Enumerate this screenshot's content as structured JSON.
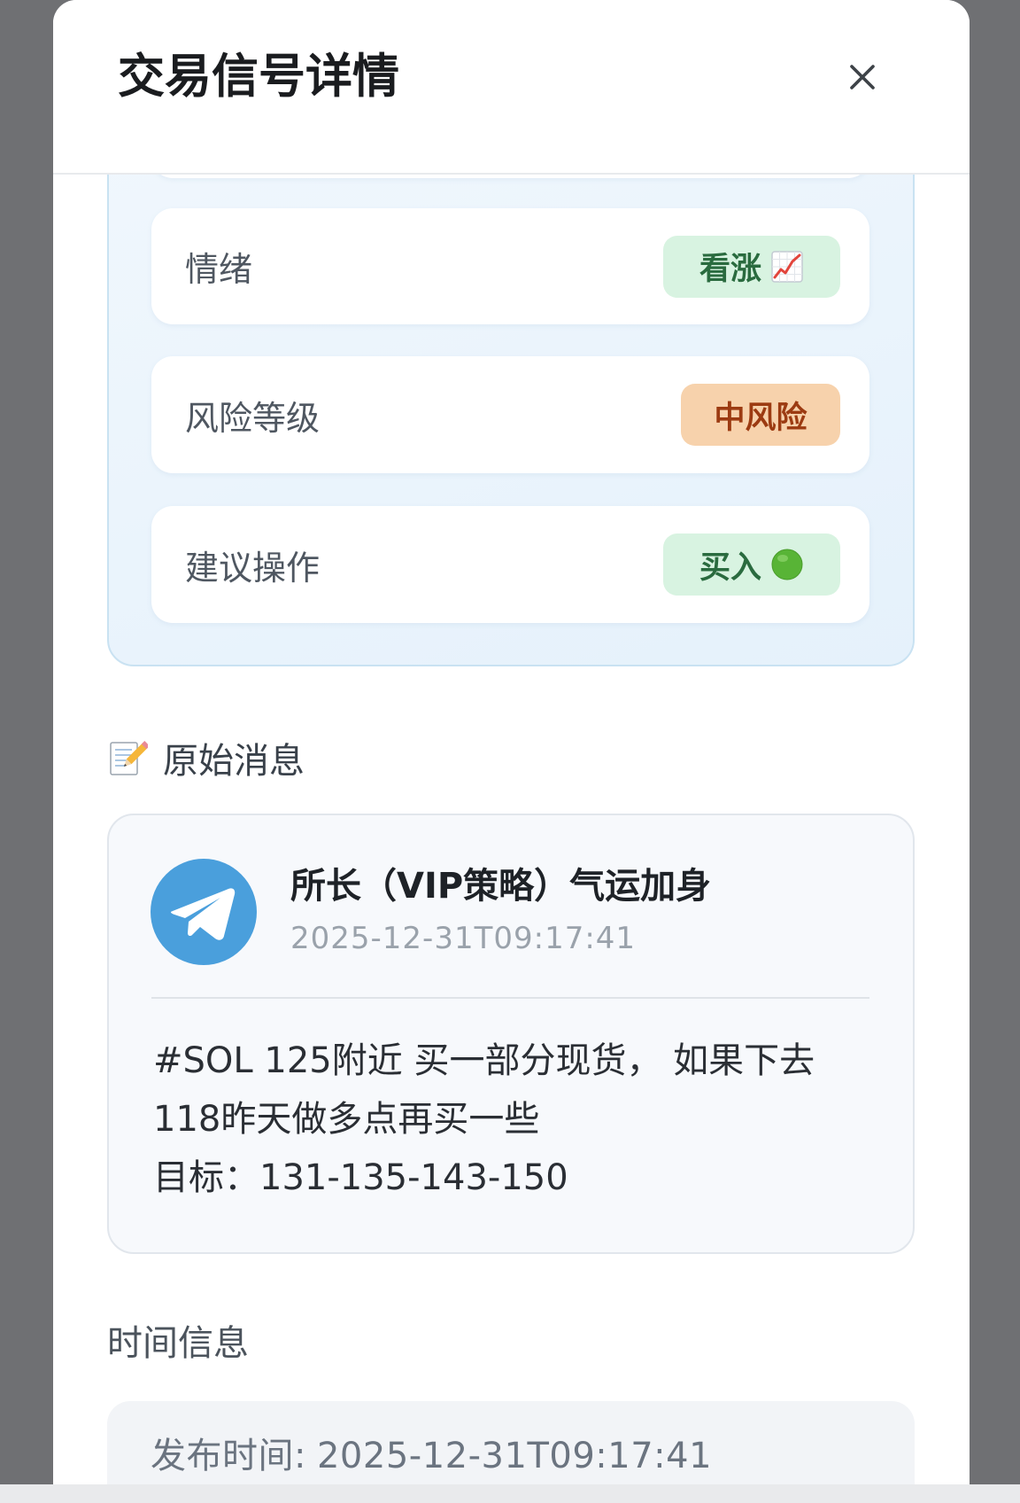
{
  "modal": {
    "title": "交易信号详情",
    "close_icon": "close-icon"
  },
  "signal": {
    "rows": [
      {
        "label": "情绪",
        "value": "看涨",
        "icon": "chart-increasing-icon",
        "badge_bg": "#d8f3e1",
        "badge_fg": "#2a6b3f"
      },
      {
        "label": "风险等级",
        "value": "中风险",
        "badge_bg": "#f7d2ac",
        "badge_fg": "#9c3b12"
      },
      {
        "label": "建议操作",
        "value": "买入",
        "icon": "green-circle-icon",
        "badge_bg": "#d8f3e1",
        "badge_fg": "#2a6b3f"
      }
    ]
  },
  "original_message": {
    "section_icon": "memo-icon",
    "section_title": "原始消息",
    "avatar_icon": "telegram-icon",
    "channel_name": "所长（VIP策略）气运加身",
    "timestamp": "2025-12-31T09:17:41",
    "lines": [
      "#SOL 125附近 买一部分现货， 如果下去",
      "118昨天做多点再买一些",
      "目标：131-135-143-150"
    ]
  },
  "time_info": {
    "section_title": "时间信息",
    "publish_label": "发布时间:",
    "publish_time": "2025-12-31T09:17:41"
  },
  "colors": {
    "telegram_blue": "#4a9fdc",
    "signal_card_border": "#c9e2f2"
  }
}
